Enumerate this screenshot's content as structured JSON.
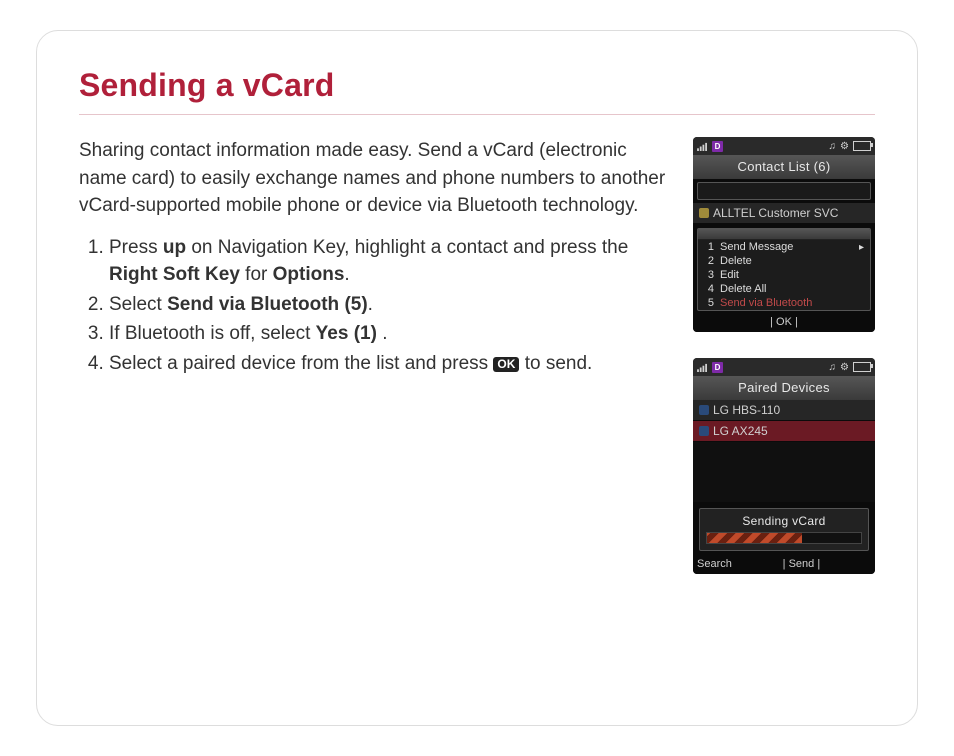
{
  "title": "Sending a vCard",
  "intro": "Sharing contact information made easy. Send a vCard (electronic name card) to easily exchange names and phone numbers to another vCard-supported mobile phone or device via Bluetooth technology.",
  "steps": {
    "s1a": "Press ",
    "s1b": "up",
    "s1c": " on Navigation Key, highlight a contact and press the ",
    "s1d": "Right Soft Key",
    "s1e": " for ",
    "s1f": "Options",
    "s1g": ".",
    "s2a": "Select ",
    "s2b": "Send via Bluetooth (5)",
    "s2c": ".",
    "s3a": "If Bluetooth is off, select ",
    "s3b": "Yes (1)",
    "s3c": " .",
    "s4a": "Select a paired device from the list and press ",
    "s4_ok": "OK",
    "s4b": " to send."
  },
  "phone1": {
    "header": "Contact List (6)",
    "contact": "ALLTEL Customer SVC",
    "menu": {
      "m1": "Send Message",
      "m2": "Delete",
      "m3": "Edit",
      "m4": "Delete All",
      "m5": "Send via Bluetooth"
    },
    "soft_center": "OK"
  },
  "phone2": {
    "header": "Paired Devices",
    "dev1": "LG HBS-110",
    "dev2": "LG AX245",
    "progress_label": "Sending vCard",
    "soft_left": "Search",
    "soft_center": "Send"
  },
  "status": {
    "d": "D"
  }
}
